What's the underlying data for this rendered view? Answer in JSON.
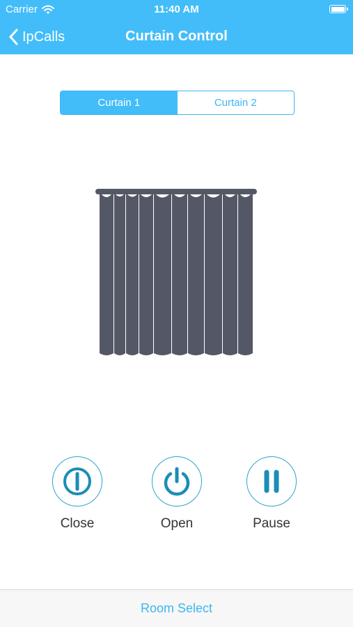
{
  "status_bar": {
    "carrier": "Carrier",
    "time": "11:40 AM",
    "wifi_icon": "wifi-icon",
    "battery_icon": "battery-icon"
  },
  "nav": {
    "back_label": "IpCalls",
    "title": "Curtain Control",
    "background": "#42bdf9"
  },
  "segments": {
    "items": [
      {
        "label": "Curtain 1",
        "selected": true
      },
      {
        "label": "Curtain 2",
        "selected": false
      }
    ]
  },
  "curtain": {
    "icon": "curtain-icon",
    "color": "#545866"
  },
  "controls": [
    {
      "label": "Close",
      "icon": "power-toggle-icon"
    },
    {
      "label": "Open",
      "icon": "power-icon"
    },
    {
      "label": "Pause",
      "icon": "pause-icon"
    }
  ],
  "bottom": {
    "room_select": "Room Select"
  },
  "colors": {
    "accent": "#3cb5f3",
    "icon_teal": "#1b8db8"
  }
}
